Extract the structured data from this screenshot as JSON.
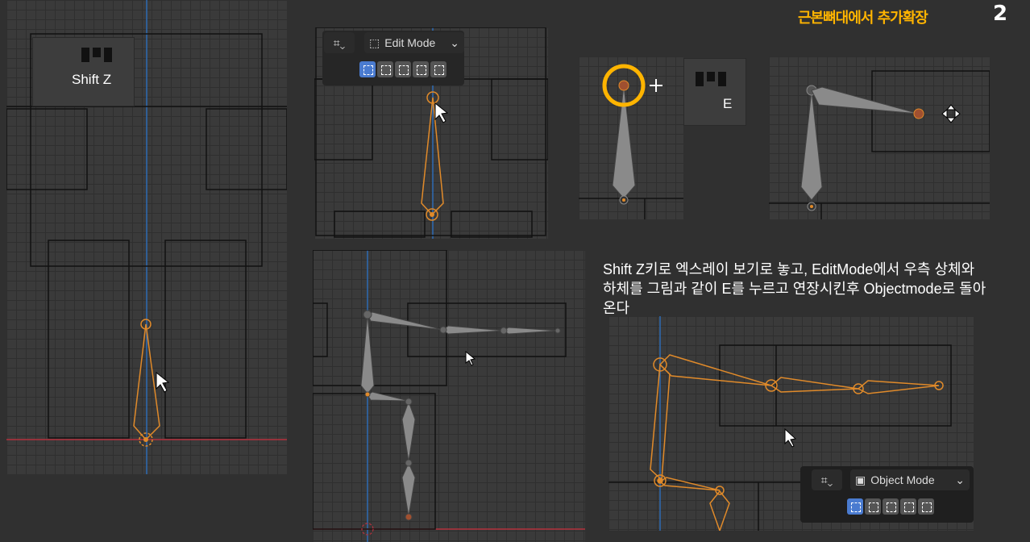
{
  "header": {
    "title": "근본뼈대에서 추가확장",
    "page_number": "2"
  },
  "panel1": {
    "shortcut_label": "Shift Z"
  },
  "panel2": {
    "toolbar": {
      "mode_label": "Edit Mode",
      "mode_icon": "edit-mode-icon",
      "snap_icon": "snap-icon"
    }
  },
  "panel4": {
    "shortcut_label": "E"
  },
  "caption": {
    "text": "Shift Z키로 엑스레이 보기로 놓고, EditMode에서 우측 상체와 하체를 그림과 같이 E를 누르고 연장시킨후 Objectmode로 돌아온다"
  },
  "panel8": {
    "toolbar": {
      "mode_label": "Object Mode",
      "mode_icon": "object-mode-icon",
      "snap_icon": "snap-icon"
    }
  },
  "colors": {
    "accent_title": "#ffb400",
    "bone_selected": "#e08a2a",
    "bone_unselected": "#8a8a8a",
    "highlight_ring": "#ffb400",
    "axis_blue": "#2d6bb3",
    "axis_red": "#b3313d"
  }
}
